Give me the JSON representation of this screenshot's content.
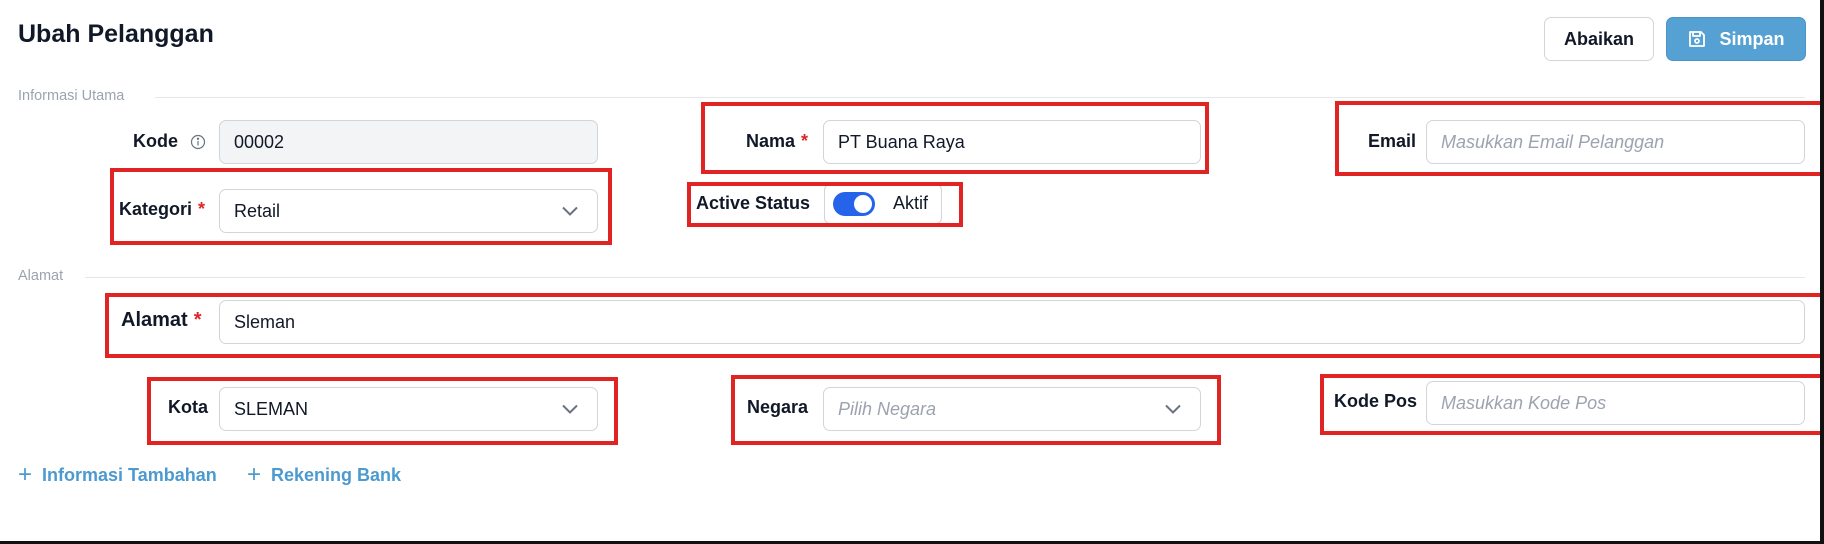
{
  "header": {
    "title": "Ubah Pelanggan",
    "cancel_label": "Abaikan",
    "save_label": "Simpan"
  },
  "sections": {
    "main": "Informasi Utama",
    "address": "Alamat"
  },
  "fields": {
    "kode": {
      "label": "Kode",
      "value": "00002"
    },
    "nama": {
      "label": "Nama",
      "value": "PT Buana Raya"
    },
    "email": {
      "label": "Email",
      "placeholder": "Masukkan Email Pelanggan"
    },
    "kategori": {
      "label": "Kategori",
      "value": "Retail"
    },
    "active_status": {
      "label": "Active Status",
      "value": "Aktif",
      "on": true
    },
    "alamat": {
      "label": "Alamat",
      "value": "Sleman"
    },
    "kota": {
      "label": "Kota",
      "value": "SLEMAN"
    },
    "negara": {
      "label": "Negara",
      "placeholder": "Pilih Negara"
    },
    "kode_pos": {
      "label": "Kode Pos",
      "placeholder": "Masukkan Kode Pos"
    }
  },
  "required_mark": "*",
  "links": {
    "info_tambahan": "Informasi Tambahan",
    "rekening_bank": "Rekening Bank"
  },
  "colors": {
    "primary": "#56a1d4",
    "toggle_on": "#2563eb",
    "required": "#dc2626",
    "highlight": "#e02424",
    "link": "#4c9acf"
  }
}
